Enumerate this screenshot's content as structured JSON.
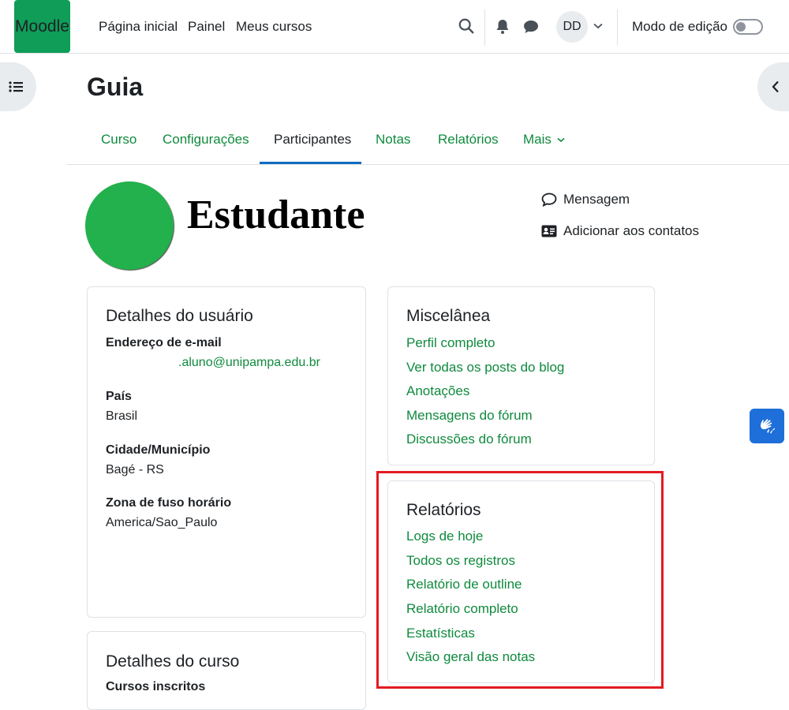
{
  "navbar": {
    "logo": "Moodle",
    "links": [
      "Página inicial",
      "Painel",
      "Meus cursos"
    ],
    "user_initials": "DD",
    "edit_mode_label": "Modo de edição"
  },
  "course": {
    "title": "Guia",
    "tabs": [
      "Curso",
      "Configurações",
      "Participantes",
      "Notas",
      "Relatórios",
      "Mais"
    ]
  },
  "profile": {
    "name": "Estudante",
    "actions": {
      "message": "Mensagem",
      "add_contact": "Adicionar aos contatos"
    }
  },
  "user_details": {
    "title": "Detalhes do usuário",
    "email_label": "Endereço de e-mail",
    "email_value": ".aluno@unipampa.edu.br",
    "country_label": "País",
    "country_value": "Brasil",
    "city_label": "Cidade/Município",
    "city_value": "Bagé - RS",
    "timezone_label": "Zona de fuso horário",
    "timezone_value": "America/Sao_Paulo"
  },
  "course_details": {
    "title": "Detalhes do curso",
    "enrolled_label": "Cursos inscritos"
  },
  "misc": {
    "title": "Miscelânea",
    "links": [
      "Perfil completo",
      "Ver todas os posts do blog",
      "Anotações",
      "Mensagens do fórum",
      "Discussões do fórum"
    ]
  },
  "reports": {
    "title": "Relatórios",
    "links": [
      "Logs de hoje",
      "Todos os registros",
      "Relatório de outline",
      "Relatório completo",
      "Estatísticas",
      "Visão geral das notas"
    ]
  },
  "colors": {
    "brand": "#0f9d58",
    "link": "#0f8a3e",
    "active_tab": "#0f6cbf",
    "highlight": "#e31b23",
    "avatar": "#22b14c"
  }
}
